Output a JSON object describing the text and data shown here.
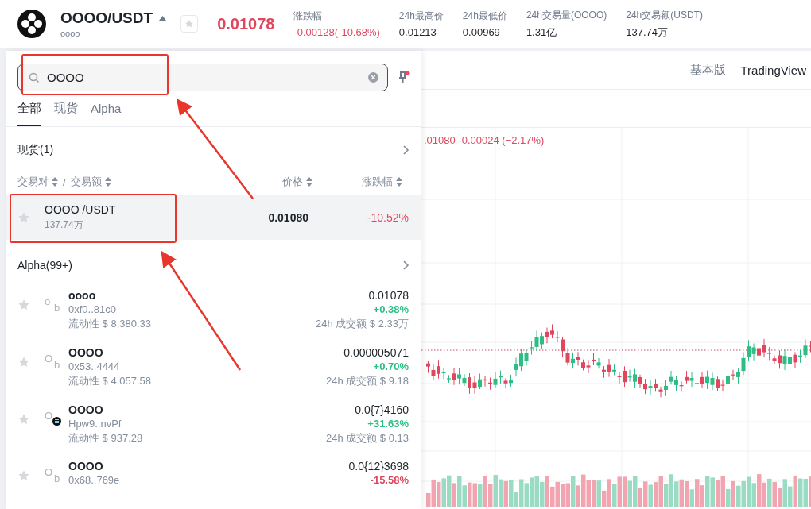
{
  "header": {
    "pair": "OOOO/USDT",
    "name": "oooo",
    "favorite": false,
    "price": "0.01078",
    "stats": [
      {
        "label": "涨跌幅",
        "value": "-0.00128(-10.68%)",
        "color": "#e0475e"
      },
      {
        "label": "24h最高价",
        "value": "0.01213"
      },
      {
        "label": "24h最低价",
        "value": "0.00969"
      },
      {
        "label": "24h交易量(OOOO)",
        "value": "1.31亿"
      },
      {
        "label": "24h交易额(USDT)",
        "value": "137.74万"
      }
    ]
  },
  "search": {
    "value": "OOOO",
    "annotated": true,
    "pin_alert": true
  },
  "tabs": [
    {
      "label": "全部",
      "selected": true
    },
    {
      "label": "现货",
      "selected": false
    },
    {
      "label": "Alpha",
      "selected": false
    }
  ],
  "spot": {
    "title": "现货(1)",
    "columns": [
      "交易对",
      "交易额",
      "价格",
      "涨跌幅"
    ],
    "column_separator": "/",
    "rows": [
      {
        "pair": "OOOO /USDT",
        "volume": "137.74万",
        "price": "0.01080",
        "change": "-10.52%",
        "color": "#e0475e",
        "favorite": false,
        "selected": true,
        "annotated": true
      }
    ]
  },
  "alpha": {
    "title": "Alpha(99+)",
    "rows": [
      {
        "name": "oooo",
        "logo_alt": "o",
        "chain": {
          "kind": "text",
          "text": "b"
        },
        "address": "0xf0..81c0",
        "liquidity": "流动性 $ 8,380.33",
        "price": "0.01078",
        "change": "+0.38%",
        "color": "#2ebd85",
        "volume": "24h 成交额 $ 2.33万",
        "favorite": false
      },
      {
        "name": "OOOO",
        "logo_alt": "O",
        "chain": {
          "kind": "text",
          "text": "b"
        },
        "address": "0x53..4444",
        "liquidity": "流动性 $ 4,057.58",
        "price": "0.000005071",
        "change": "+0.70%",
        "color": "#2ebd85",
        "volume": "24h 成交额 $ 9.18",
        "favorite": false
      },
      {
        "name": "OOOO",
        "logo_alt": "O",
        "chain": {
          "kind": "icon"
        },
        "address": "Hpw9..nvPf",
        "liquidity": "流动性 $ 937.28",
        "price": "0.0{7}4160",
        "change": "+31.63%",
        "color": "#2ebd85",
        "volume": "24h 成交额 $ 0.13",
        "favorite": false
      },
      {
        "name": "OOOO",
        "logo_alt": "O",
        "chain": {
          "kind": "text",
          "text": "b"
        },
        "address": "0x68..769e",
        "price": "0.0{12}3698",
        "change": "-15.58%",
        "color": "#e0475e",
        "favorite": false
      }
    ]
  },
  "chart_toolbar": [
    {
      "label": "基本版",
      "selected": false
    },
    {
      "label": "TradingView",
      "selected": true
    }
  ],
  "chart_legend": {
    "text": ".01080 -0.00024 (−2.17%)",
    "color": "#e0475e"
  }
}
